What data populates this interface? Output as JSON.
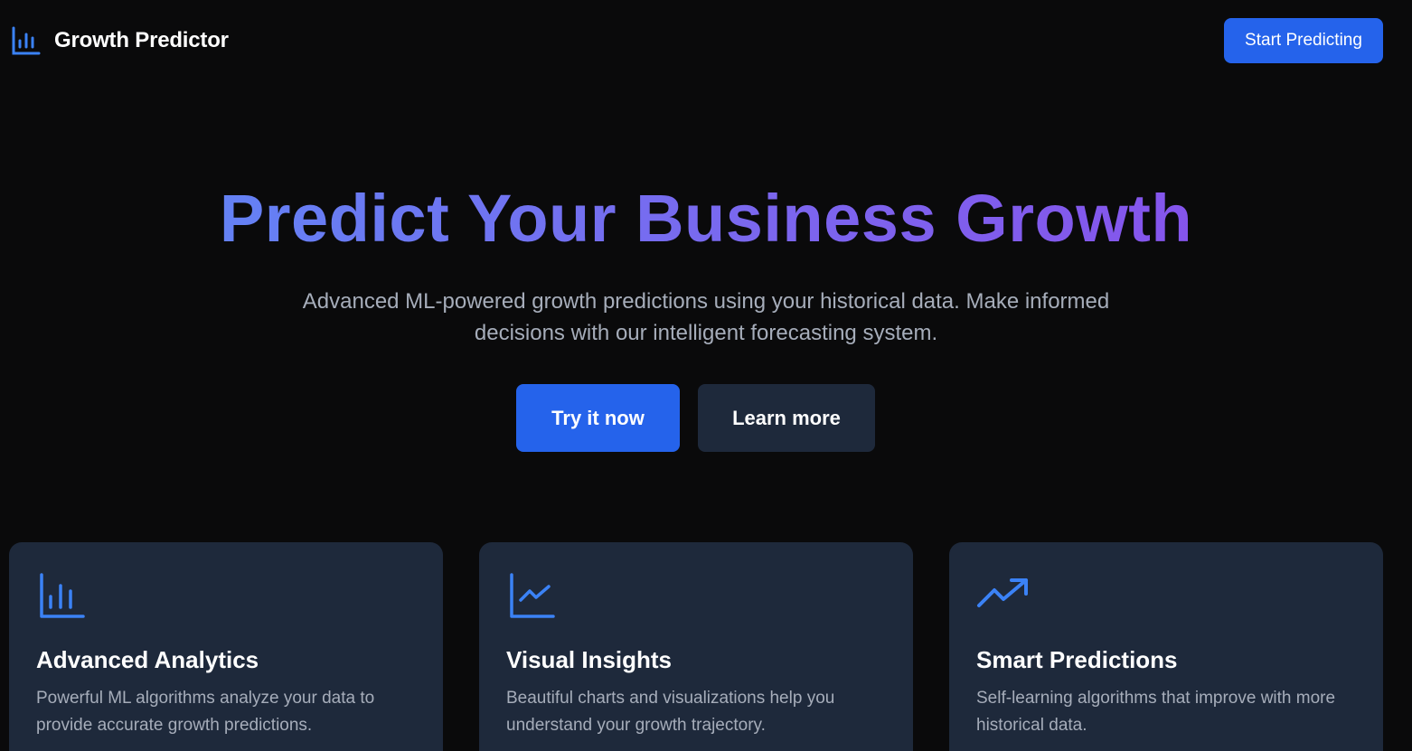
{
  "header": {
    "brand_name": "Growth Predictor",
    "brand_icon": "bar-chart-icon",
    "cta_label": "Start Predicting"
  },
  "hero": {
    "title": "Predict Your Business Growth",
    "subtitle": "Advanced ML-powered growth predictions using your historical data. Make informed decisions with our intelligent forecasting system.",
    "primary_label": "Try it now",
    "secondary_label": "Learn more"
  },
  "features": [
    {
      "icon": "bar-chart-icon",
      "title": "Advanced Analytics",
      "description": "Powerful ML algorithms analyze your data to provide accurate growth predictions."
    },
    {
      "icon": "line-chart-icon",
      "title": "Visual Insights",
      "description": "Beautiful charts and visualizations help you understand your growth trajectory."
    },
    {
      "icon": "trending-up-icon",
      "title": "Smart Predictions",
      "description": "Self-learning algorithms that improve with more historical data."
    }
  ],
  "colors": {
    "background": "#0a0a0b",
    "accent": "#2563eb",
    "card": "#1e293b",
    "icon": "#3b82f6",
    "gradient_start": "#5b8cf7",
    "gradient_end": "#8a4bea"
  }
}
